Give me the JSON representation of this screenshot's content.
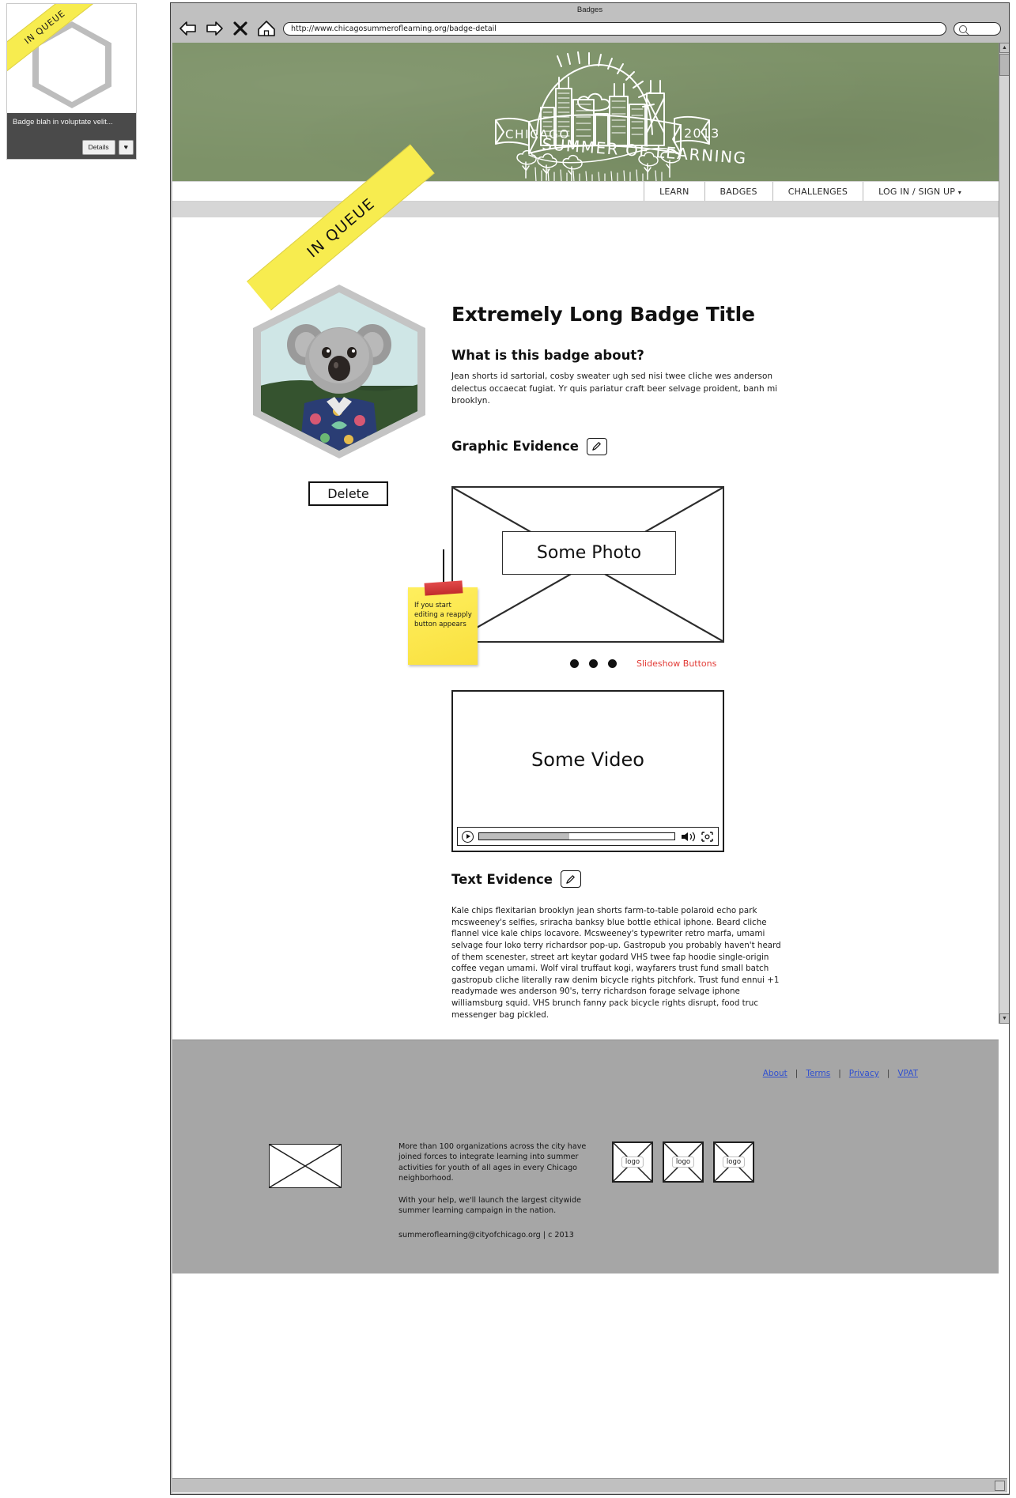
{
  "badge_card": {
    "status_ribbon": "IN QUEUE",
    "title": "Badge blah in voluptate velit...",
    "details_label": "Details",
    "favorite_icon": "heart-icon"
  },
  "browser": {
    "window_title": "Badges",
    "back_icon": "back-arrow-icon",
    "forward_icon": "forward-arrow-icon",
    "stop_icon": "close-x-icon",
    "home_icon": "home-icon",
    "url": "http://www.chicagosummeroflearning.org/badge-detail",
    "search_placeholder": "",
    "search_icon": "search-icon"
  },
  "site_header": {
    "banner_city": "CHICAGO",
    "banner_main": "SUMMER OF LEARNING",
    "banner_year": "2013",
    "background_color": "#7d9268"
  },
  "nav": {
    "items": [
      {
        "label": "LEARN"
      },
      {
        "label": "BADGES"
      },
      {
        "label": "CHALLENGES"
      },
      {
        "label": "LOG IN / SIGN UP"
      }
    ],
    "dropdown_caret": "▾"
  },
  "badge": {
    "status_ribbon": "IN QUEUE",
    "title": "Extremely Long Badge Title",
    "delete_label": "Delete",
    "about_heading": "What is this badge about?",
    "about_text": "Jean shorts id sartorial, cosby sweater ugh sed nisi twee cliche wes anderson delectus occaecat fugiat. Yr quis pariatur craft beer selvage proident, banh mi brooklyn."
  },
  "graphic_evidence": {
    "heading": "Graphic Evidence",
    "edit_icon": "pencil-edit-icon",
    "photo_label": "Some Photo",
    "slideshow_label": "Slideshow Buttons",
    "dot_count": 3,
    "slideshow_label_color": "#e23b36"
  },
  "sticky_note": {
    "text": "If you start editing a reapply button appears",
    "color": "#f9e03f",
    "tape_color": "#c22c2c"
  },
  "video_evidence": {
    "video_label": "Some Video",
    "play_icon": "play-icon",
    "volume_icon": "volume-icon",
    "fullscreen_icon": "fullscreen-icon",
    "progress_percent": 46
  },
  "text_evidence": {
    "heading": "Text Evidence",
    "edit_icon": "pencil-edit-icon",
    "text": "Kale chips flexitarian brooklyn jean shorts farm-to-table polaroid echo park mcsweeney's selfies, sriracha banksy blue bottle ethical iphone. Beard cliche flannel vice kale chips locavore. Mcsweeney's typewriter retro marfa, umami selvage four loko terry richardsor pop-up. Gastropub you probably haven't heard of them scenester, street art keytar godard VHS twee fap hoodie single-origin coffee vegan umami. Wolf viral truffaut kogi, wayfarers trust fund small batch gastropub cliche literally raw denim bicycle rights pitchfork. Trust fund ennui +1 readymade wes anderson 90's, terry richardson forage selvage iphone williamsburg squid. VHS brunch fanny pack bicycle rights disrupt, food truc messenger bag pickled."
  },
  "footer": {
    "links": [
      {
        "label": "About"
      },
      {
        "label": "Terms"
      },
      {
        "label": "Privacy"
      },
      {
        "label": "VPAT"
      }
    ],
    "separator": "|",
    "paragraph1": "More than 100 organizations across the city have joined forces to integrate learning into summer activities for youth of all ages in every Chicago neighborhood.",
    "paragraph2": "With your help, we'll launch the largest citywide summer learning campaign in the nation.",
    "email_line": "summeroflearning@cityofchicago.org | c 2013",
    "partner_logos": [
      {
        "label": "logo"
      },
      {
        "label": "logo"
      },
      {
        "label": "logo"
      }
    ],
    "background_color": "#a6a6a6",
    "link_color": "#2f4fd0"
  }
}
